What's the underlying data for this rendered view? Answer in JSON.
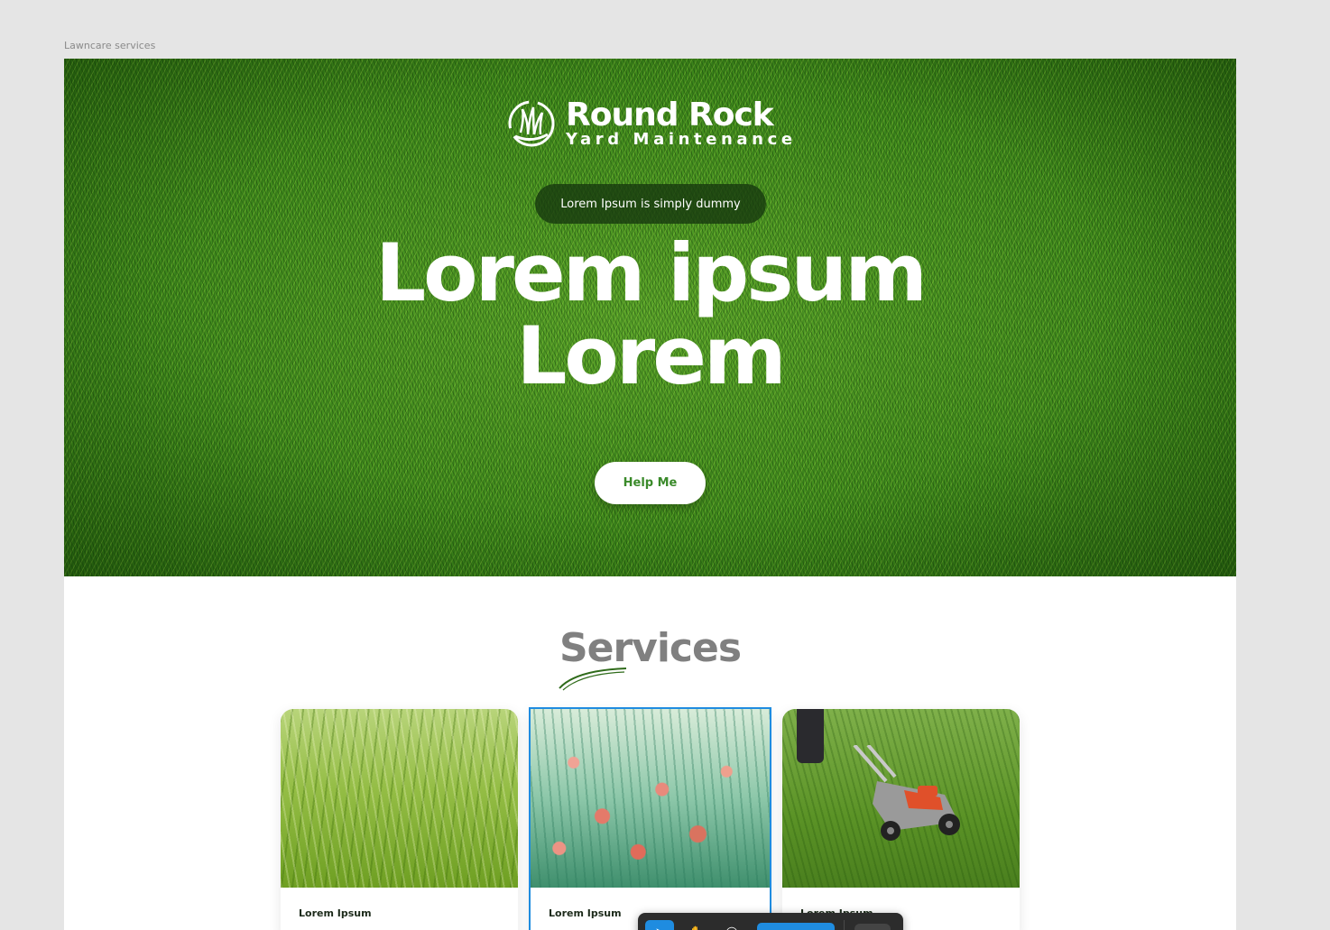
{
  "frame": {
    "label": "Lawncare services"
  },
  "hero": {
    "brand_title": "Round Rock",
    "brand_subtitle": "Yard Maintenance",
    "tagline": "Lorem Ipsum is simply dummy",
    "headline_line1": "Lorem ipsum",
    "headline_line2": "Lorem",
    "cta_label": "Help Me"
  },
  "services": {
    "title": "Services",
    "cards": [
      {
        "title": "Lorem Ipsum",
        "image": "tall-grass-photo"
      },
      {
        "title": "Lorem Ipsum",
        "image": "wildflowers-photo"
      },
      {
        "title": "Lorem Ipsum",
        "image": "lawn-mower-photo"
      }
    ]
  },
  "colors": {
    "accent": "#3a8a2a",
    "selection": "#1f8ce0",
    "heading_gray": "#808080"
  },
  "toolbar": {
    "icons": [
      "move-tool-icon",
      "hand-tool-icon",
      "comment-tool-icon"
    ]
  }
}
